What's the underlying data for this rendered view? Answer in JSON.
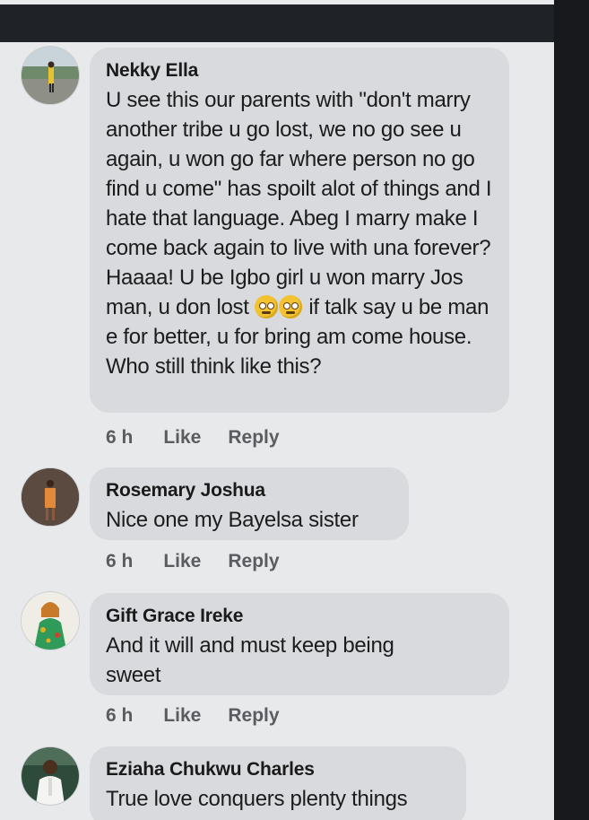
{
  "comments": [
    {
      "name": "Nekky Ella",
      "lines_before_emoji": "U see this our parents with \"don't marry another tribe u go lost, we no go see u again, u won go far where person no go find u come\" has spoilt alot of things and I hate that language. Abeg I marry make I come back again to live with una forever? Haaaa! U be Igbo girl u won marry Jos man, u don lost",
      "after_emoji": " if talk say u be man e for better, u for bring am come house. Who still think like this?",
      "emoji_name": "rolling-eyes-emoji",
      "time": "6 h",
      "like": "Like",
      "reply": "Reply"
    },
    {
      "name": "Rosemary Joshua",
      "text": "Nice one my Bayelsa sister",
      "time": "6 h",
      "like": "Like",
      "reply": "Reply"
    },
    {
      "name": "Gift Grace Ireke",
      "text": "And it will and must keep being sweet",
      "time": "6 h",
      "like": "Like",
      "reply": "Reply"
    },
    {
      "name": "Eziaha Chukwu Charles",
      "text": "True love conquers plenty things"
    }
  ]
}
